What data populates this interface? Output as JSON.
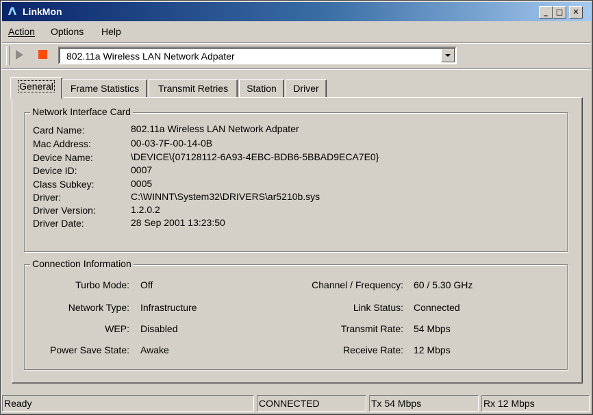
{
  "window": {
    "title": "LinkMon"
  },
  "menu": {
    "action": "Action",
    "options": "Options",
    "help": "Help"
  },
  "toolbar": {
    "adapter": "802.11a Wireless LAN Network Adpater"
  },
  "tabs": [
    {
      "label": "General"
    },
    {
      "label": "Frame Statistics"
    },
    {
      "label": "Transmit Retries"
    },
    {
      "label": "Station"
    },
    {
      "label": "Driver"
    }
  ],
  "nic": {
    "title": "Network Interface Card",
    "rows": [
      {
        "label": "Card Name:",
        "value": "802.11a Wireless LAN Network Adpater"
      },
      {
        "label": "Mac Address:",
        "value": "00-03-7F-00-14-0B"
      },
      {
        "label": "Device Name:",
        "value": "\\DEVICE\\{07128112-6A93-4EBC-BDB6-5BBAD9ECA7E0}"
      },
      {
        "label": "Device ID:",
        "value": "0007"
      },
      {
        "label": "Class Subkey:",
        "value": "0005"
      },
      {
        "label": "Driver:",
        "value": "C:\\WINNT\\System32\\DRIVERS\\ar5210b.sys"
      },
      {
        "label": "Driver Version:",
        "value": "1.2.0.2"
      },
      {
        "label": "Driver Date:",
        "value": "28 Sep 2001 13:23:50"
      }
    ]
  },
  "conn": {
    "title": "Connection Information",
    "left": [
      {
        "label": "Turbo Mode:",
        "value": "Off"
      },
      {
        "label": "Network Type:",
        "value": "Infrastructure"
      },
      {
        "label": "WEP:",
        "value": "Disabled"
      },
      {
        "label": "Power Save State:",
        "value": "Awake"
      }
    ],
    "right": [
      {
        "label": "Channel / Frequency:",
        "value": "60 / 5.30 GHz"
      },
      {
        "label": "Link Status:",
        "value": "Connected"
      },
      {
        "label": "Transmit Rate:",
        "value": "54 Mbps"
      },
      {
        "label": "Receive Rate:",
        "value": "12 Mbps"
      }
    ]
  },
  "status": {
    "ready": "Ready",
    "connection": "CONNECTED",
    "tx": "Tx 54 Mbps",
    "rx": "Rx 12 Mbps"
  }
}
